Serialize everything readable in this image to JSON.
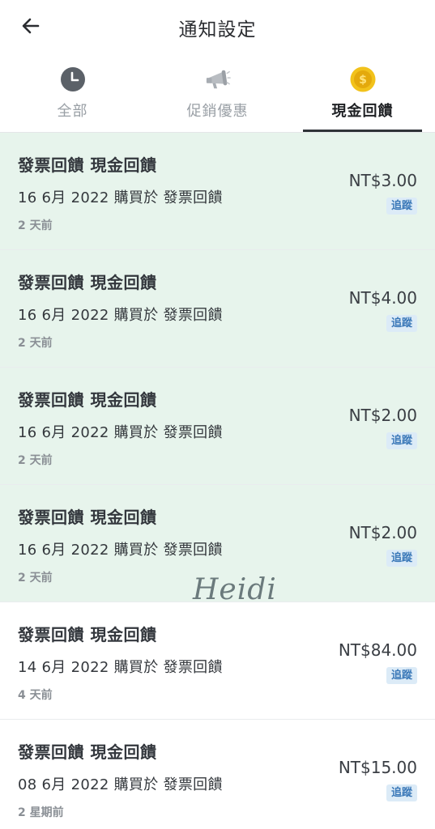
{
  "header": {
    "title": "通知設定",
    "back_icon": "arrow-left-icon"
  },
  "tabs": [
    {
      "label": "全部",
      "icon": "clock-icon",
      "active": false
    },
    {
      "label": "促銷優惠",
      "icon": "megaphone-icon",
      "active": false
    },
    {
      "label": "現金回饋",
      "icon": "dollar-coin-icon",
      "active": true
    }
  ],
  "colors": {
    "unread_bg": "#e7f4ec",
    "badge_bg": "#dcebf7",
    "badge_text": "#3a78b8",
    "coin": "#f2c21b"
  },
  "notifications": [
    {
      "title": "發票回饋 現金回饋",
      "desc": "16 6月 2022 購買於 發票回饋",
      "time": "2 天前",
      "amount": "NT$3.00",
      "badge": "追蹤",
      "unread": true
    },
    {
      "title": "發票回饋 現金回饋",
      "desc": "16 6月 2022 購買於 發票回饋",
      "time": "2 天前",
      "amount": "NT$4.00",
      "badge": "追蹤",
      "unread": true
    },
    {
      "title": "發票回饋 現金回饋",
      "desc": "16 6月 2022 購買於 發票回饋",
      "time": "2 天前",
      "amount": "NT$2.00",
      "badge": "追蹤",
      "unread": true
    },
    {
      "title": "發票回饋 現金回饋",
      "desc": "16 6月 2022 購買於 發票回饋",
      "time": "2 天前",
      "amount": "NT$2.00",
      "badge": "追蹤",
      "unread": true
    },
    {
      "title": "發票回饋 現金回饋",
      "desc": "14 6月 2022 購買於 發票回饋",
      "time": "4 天前",
      "amount": "NT$84.00",
      "badge": "追蹤",
      "unread": false
    },
    {
      "title": "發票回饋 現金回饋",
      "desc": "08 6月 2022 購買於 發票回饋",
      "time": "2 星期前",
      "amount": "NT$15.00",
      "badge": "追蹤",
      "unread": false
    }
  ],
  "watermark": "Heidi"
}
